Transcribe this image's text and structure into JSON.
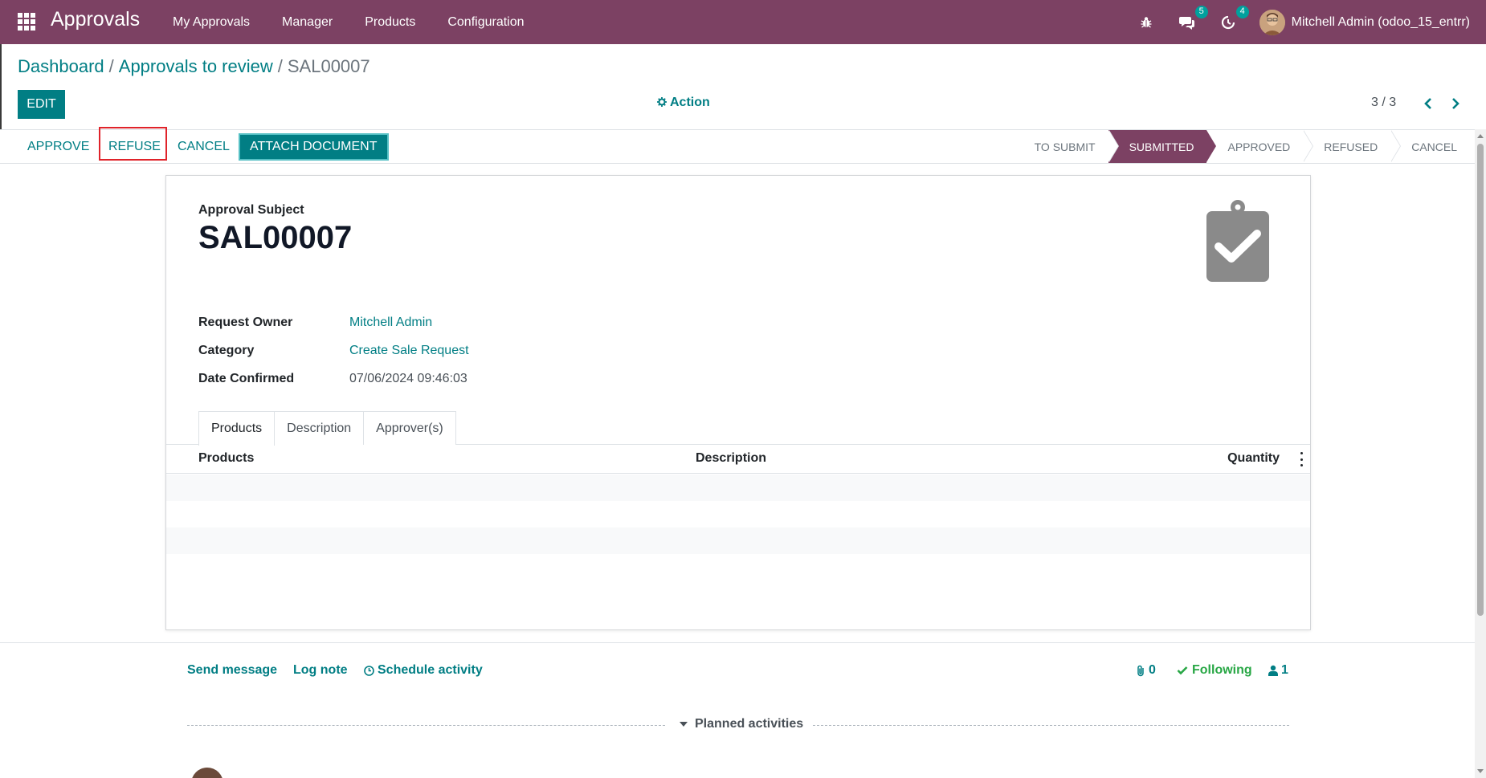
{
  "navbar": {
    "app_title": "Approvals",
    "menu": [
      "My Approvals",
      "Manager",
      "Products",
      "Configuration"
    ],
    "messages_badge": "5",
    "activities_badge": "4",
    "user_name": "Mitchell Admin (odoo_15_entrr)",
    "bg_color": "#7c4163"
  },
  "breadcrumb": {
    "items": [
      "Dashboard",
      "Approvals to review"
    ],
    "current": "SAL00007"
  },
  "control_panel": {
    "edit_label": "EDIT",
    "action_label": "Action",
    "pager": "3 / 3"
  },
  "statusbar": {
    "buttons": [
      "APPROVE",
      "REFUSE",
      "CANCEL",
      "ATTACH DOCUMENT"
    ],
    "highlighted_button": "REFUSE",
    "stages": [
      "TO SUBMIT",
      "SUBMITTED",
      "APPROVED",
      "REFUSED",
      "CANCEL"
    ],
    "active_stage": "SUBMITTED"
  },
  "form": {
    "subject_label": "Approval Subject",
    "subject_value": "SAL00007",
    "fields": [
      {
        "label": "Request Owner",
        "value": "Mitchell Admin"
      },
      {
        "label": "Category",
        "value": "Create Sale Request"
      },
      {
        "label": "Date Confirmed",
        "value": "07/06/2024 09:46:03"
      }
    ],
    "tabs": [
      "Products",
      "Description",
      "Approver(s)"
    ],
    "active_tab": "Products",
    "table_columns": [
      "Products",
      "Description",
      "Quantity"
    ]
  },
  "chatter": {
    "send_message": "Send message",
    "log_note": "Log note",
    "schedule_activity": "Schedule activity",
    "attachments_count": "0",
    "following_label": "Following",
    "followers_count": "1",
    "planned_activities": "Planned activities"
  },
  "colors": {
    "accent": "#017e84",
    "brand": "#7c4163",
    "highlight_outline": "#e0232a",
    "following_green": "#28a745"
  }
}
